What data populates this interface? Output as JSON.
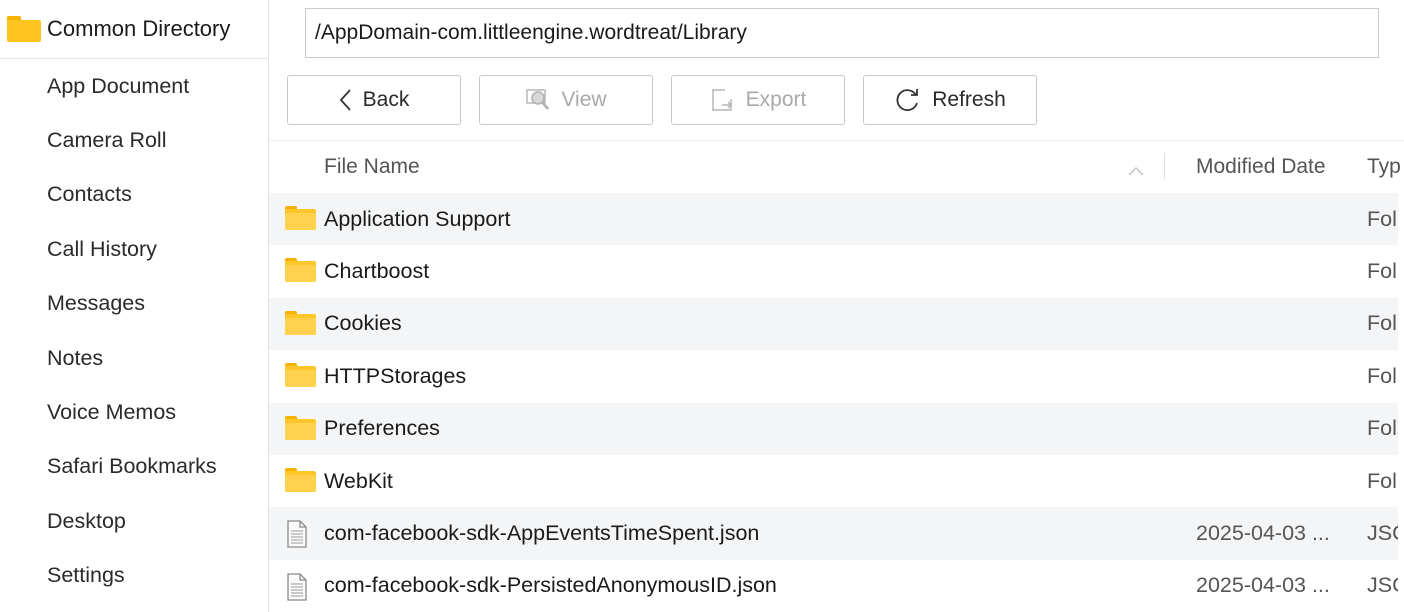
{
  "sidebar": {
    "title": "Common Directory",
    "items": [
      {
        "label": "App Document"
      },
      {
        "label": "Camera Roll"
      },
      {
        "label": "Contacts"
      },
      {
        "label": "Call History"
      },
      {
        "label": "Messages"
      },
      {
        "label": "Notes"
      },
      {
        "label": "Voice Memos"
      },
      {
        "label": "Safari Bookmarks"
      },
      {
        "label": "Desktop"
      },
      {
        "label": "Settings"
      }
    ]
  },
  "path": "/AppDomain-com.littleengine.wordtreat/Library",
  "toolbar": {
    "back": "Back",
    "view": "View",
    "export": "Export",
    "refresh": "Refresh"
  },
  "table": {
    "headers": {
      "name": "File Name",
      "date": "Modified Date",
      "type": "Typ"
    },
    "rows": [
      {
        "icon": "folder-icon",
        "name": "Application Support",
        "date": "",
        "type": "Fol"
      },
      {
        "icon": "folder-icon",
        "name": "Chartboost",
        "date": "",
        "type": "Fol"
      },
      {
        "icon": "folder-icon",
        "name": "Cookies",
        "date": "",
        "type": "Fol"
      },
      {
        "icon": "folder-icon",
        "name": "HTTPStorages",
        "date": "",
        "type": "Fol"
      },
      {
        "icon": "folder-icon",
        "name": "Preferences",
        "date": "",
        "type": "Fol"
      },
      {
        "icon": "folder-icon",
        "name": "WebKit",
        "date": "",
        "type": "Fol"
      },
      {
        "icon": "file-icon",
        "name": "com-facebook-sdk-AppEventsTimeSpent.json",
        "date": "2025-04-03 ...",
        "type": "JSC"
      },
      {
        "icon": "file-icon",
        "name": "com-facebook-sdk-PersistedAnonymousID.json",
        "date": "2025-04-03 ...",
        "type": "JSC"
      }
    ]
  },
  "colors": {
    "folder": "#ffc41f",
    "row_alt": "#f4f5f7",
    "disabled_text": "#a9a9a9"
  }
}
